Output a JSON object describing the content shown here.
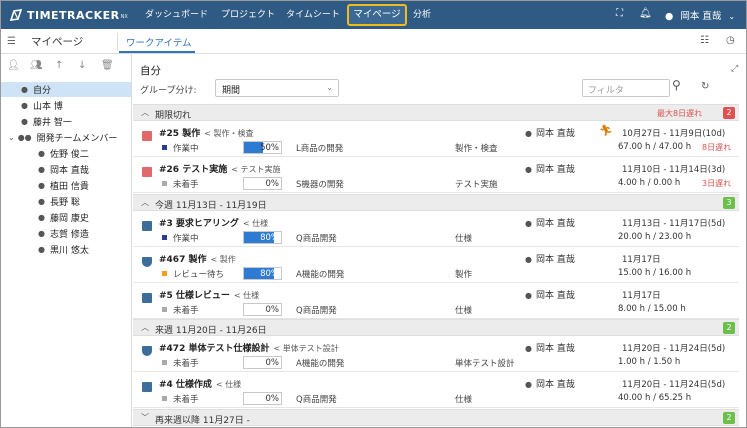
{
  "app": {
    "logo_text": "TIMETRACKER",
    "logo_sub": "NX"
  },
  "nav": {
    "items": [
      "ダッシュボード",
      "プロジェクト",
      "タイムシート"
    ],
    "active": "マイページ",
    "last": "分析",
    "user": "岡本 直哉"
  },
  "subbar": {
    "title": "マイページ",
    "tab": "ワークアイテム"
  },
  "tree": {
    "items": [
      {
        "label": "自分",
        "selected": true
      },
      {
        "label": "山本 博"
      },
      {
        "label": "藤井 智一"
      },
      {
        "label": "開発チームメンバー"
      },
      {
        "label": "佐野 俊二"
      },
      {
        "label": "岡本 直哉"
      },
      {
        "label": "植田 信貴"
      },
      {
        "label": "長野 聡"
      },
      {
        "label": "藤岡 康史"
      },
      {
        "label": "志賀 修造"
      },
      {
        "label": "黒川 悠太"
      }
    ]
  },
  "main": {
    "title": "自分",
    "group_label": "グループ分け:",
    "group_value": "期間",
    "filter_placeholder": "フィルタ"
  },
  "groups": [
    {
      "title": "期限切れ",
      "late": "最大8日遅れ",
      "count": "2",
      "count_color": "#e05252"
    },
    {
      "title": "今週 11月13日 - 11月19日",
      "count": "3",
      "count_color": "#6cbf4a"
    },
    {
      "title": "来週 11月20日 - 11月26日",
      "count": "2",
      "count_color": "#6cbf4a"
    },
    {
      "title": "再来週以降 11月27日 -",
      "count": "2",
      "count_color": "#6cbf4a"
    }
  ],
  "rows": [
    {
      "name": "#25 製作",
      "parent": "< 製作・検査",
      "status": "作業中",
      "status_color": "#2a3f8f",
      "progress": 50,
      "progress_label": "50%",
      "project": "L商品の開発",
      "category": "製作・検査",
      "assignee": "岡本 直哉",
      "dates": "10月27日 - 11月9日(10d)",
      "hours": "67.00 h / 47.00 h",
      "late": "8日遅れ",
      "icon_color": "#e06a6a",
      "runner": true
    },
    {
      "name": "#26 テスト実施",
      "parent": "< テスト実施",
      "status": "未着手",
      "status_color": "#aaaaaa",
      "progress": 0,
      "progress_label": "0%",
      "project": "S機器の開発",
      "category": "テスト実施",
      "assignee": "岡本 直哉",
      "dates": "11月10日 - 11月14日(3d)",
      "hours": "4.00 h / 0.00 h",
      "late": "3日遅れ",
      "icon_color": "#e06a6a"
    },
    {
      "name": "#3 要求ヒアリング",
      "parent": "< 仕様",
      "status": "作業中",
      "status_color": "#2a3f8f",
      "progress": 80,
      "progress_label": "80%",
      "project": "Q商品開発",
      "category": "仕様",
      "assignee": "岡本 直哉",
      "dates": "11月13日 - 11月17日(5d)",
      "hours": "20.00 h / 23.00 h",
      "icon_color": "#3d6e99"
    },
    {
      "name": "#467 製作",
      "parent": "< 製作",
      "status": "レビュー待ち",
      "status_color": "#f0a020",
      "progress": 80,
      "progress_label": "80%",
      "project": "A機能の開発",
      "category": "製作",
      "assignee": "岡本 直哉",
      "dates": "11月17日",
      "hours": "15.00 h / 16.00 h",
      "icon_color": "#3d6e99",
      "shield": true
    },
    {
      "name": "#5 仕様レビュー",
      "parent": "< 仕様",
      "status": "未着手",
      "status_color": "#aaaaaa",
      "progress": 0,
      "progress_label": "0%",
      "project": "Q商品開発",
      "category": "仕様",
      "assignee": "岡本 直哉",
      "dates": "11月17日",
      "hours": "8.00 h / 15.00 h",
      "icon_color": "#3d6e99"
    },
    {
      "name": "#472 単体テスト仕様設計",
      "parent": "< 単体テスト設計",
      "status": "未着手",
      "status_color": "#aaaaaa",
      "progress": 0,
      "progress_label": "0%",
      "project": "A機能の開発",
      "category": "単体テスト設計",
      "assignee": "岡本 直哉",
      "dates": "11月20日 - 11月24日(5d)",
      "hours": "1.00 h / 1.50 h",
      "icon_color": "#3d6e99",
      "shield": true
    },
    {
      "name": "#4 仕様作成",
      "parent": "< 仕様",
      "status": "未着手",
      "status_color": "#aaaaaa",
      "progress": 0,
      "progress_label": "0%",
      "project": "Q商品開発",
      "category": "仕様",
      "assignee": "岡本 直哉",
      "dates": "11月20日 - 11月24日(5d)",
      "hours": "40.00 h / 65.25 h",
      "icon_color": "#3d6e99"
    }
  ]
}
